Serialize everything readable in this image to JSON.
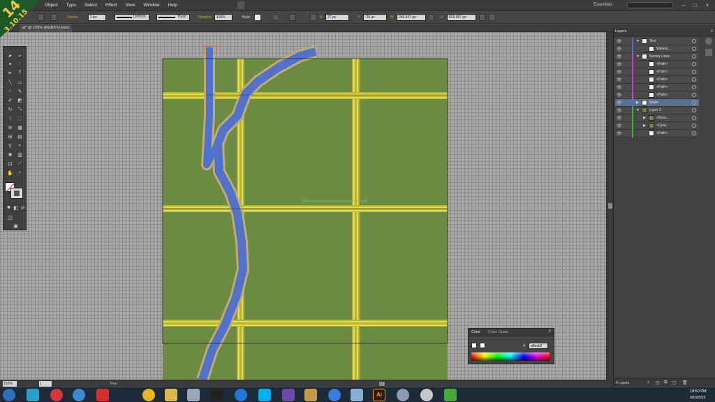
{
  "badge": {
    "number": "14",
    "date": "3.10.15"
  },
  "menubar": {
    "menus": [
      "Object",
      "Type",
      "Select",
      "Effect",
      "View",
      "Window",
      "Help"
    ],
    "workspace": "Essentials"
  },
  "controlbar": {
    "stroke_label": "Stroke:",
    "stroke_weight": "1 px",
    "profile": "Uniform",
    "brush": "Basic",
    "opacity_label": "Opacity:",
    "opacity": "100%",
    "style_label": "Style:",
    "x_value": "27 px",
    "y_label": "Y:",
    "y_value": "-26 px",
    "w_value": "246.667 px",
    "h_label": "H:",
    "h_value": "603.997 px"
  },
  "document": {
    "tab_label": "ai* @ 150% (RGB/Preview)"
  },
  "status": {
    "zoom": "150%",
    "page": "1",
    "tool": "Pen"
  },
  "layers_panel": {
    "tab": "Layers",
    "count": "4 Layers",
    "rows": [
      {
        "name": "Text",
        "indent": 0,
        "expanded": true,
        "color": "#4a6bd8",
        "thumb": "white"
      },
      {
        "name": "Waterw...",
        "indent": 1,
        "expanded": null,
        "color": "#4a6bd8",
        "thumb": "white"
      },
      {
        "name": "Survey Lines",
        "indent": 0,
        "expanded": true,
        "color": "#c043c0",
        "thumb": "white"
      },
      {
        "name": "<Path>",
        "indent": 1,
        "expanded": null,
        "color": "#c043c0",
        "thumb": "white"
      },
      {
        "name": "<Path>",
        "indent": 1,
        "expanded": null,
        "color": "#c043c0",
        "thumb": "white"
      },
      {
        "name": "<Path>",
        "indent": 1,
        "expanded": null,
        "color": "#c043c0",
        "thumb": "white"
      },
      {
        "name": "<Path>",
        "indent": 1,
        "expanded": null,
        "color": "#c043c0",
        "thumb": "white"
      },
      {
        "name": "<Path>",
        "indent": 1,
        "expanded": null,
        "color": "#c043c0",
        "thumb": "white"
      },
      {
        "name": "Water",
        "indent": 0,
        "expanded": false,
        "color": "#4a6bd8",
        "thumb": "white",
        "selected": true
      },
      {
        "name": "Layer 3",
        "indent": 0,
        "expanded": true,
        "color": "#3db13d",
        "thumb": "green"
      },
      {
        "name": "<Grou...",
        "indent": 1,
        "expanded": false,
        "color": "#3db13d",
        "thumb": "green"
      },
      {
        "name": "<Grou...",
        "indent": 1,
        "expanded": false,
        "color": "#3db13d",
        "thumb": "green"
      },
      {
        "name": "<Path>",
        "indent": 1,
        "expanded": null,
        "color": "#3db13d",
        "thumb": "white"
      }
    ]
  },
  "color_panel": {
    "tab_color": "Color",
    "tab_guide": "Color Guide",
    "hex_label": "#",
    "hex_value": "a6acb2"
  },
  "taskbar": {
    "time": "10:50 PM",
    "date": "3/10/2015"
  },
  "colors": {
    "ground": "#6b8a42",
    "road": "#e3e14a",
    "road_edge": "#b8b23c",
    "water": "#4a74cf",
    "water_edge": "#c5a872",
    "selection": "#ff3a3a",
    "guide": "#222222"
  }
}
